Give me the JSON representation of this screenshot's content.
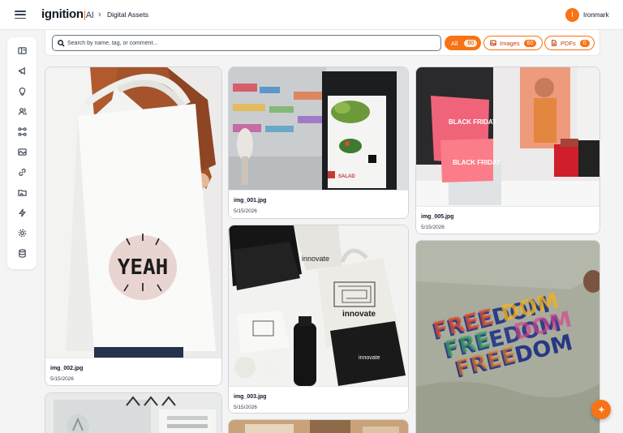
{
  "header": {
    "logo_text": "ignition",
    "logo_suffix": "AI",
    "breadcrumb_sep": "›",
    "breadcrumb": "Digital Assets",
    "user_initial": "I",
    "user_name": "Ironmark"
  },
  "sidebar": {
    "icons": [
      "dashboard-icon",
      "megaphone-icon",
      "lightbulb-icon",
      "users-icon",
      "workflow-icon",
      "image-gallery-icon",
      "link-icon",
      "folder-image-icon",
      "lightning-icon",
      "settings-icon",
      "database-icon"
    ]
  },
  "search": {
    "placeholder": "Search by name, tag, or comment...",
    "value": ""
  },
  "filters": {
    "all_label": "All",
    "all_count": "60",
    "images_label": "Images",
    "images_count": "60",
    "pdfs_label": "PDFs",
    "pdfs_count": "0"
  },
  "cards": [
    {
      "file": "img_002.jpg",
      "date": "5/15/2026"
    },
    {
      "file": "img_001.jpg",
      "date": "5/15/2026"
    },
    {
      "file": "img_003.jpg",
      "date": "5/15/2026"
    },
    {
      "file": "img_005.jpg",
      "date": "5/15/2026"
    }
  ],
  "image_text": {
    "tote": "YEAH",
    "kiosk": "SALAD",
    "sale1": "BLACK FRIDAY",
    "sale2": "BLACK FRIDAY",
    "innovate": "innovate",
    "freedom": "FREEDOM"
  },
  "colors": {
    "accent": "#f97316",
    "accent_light": "#ffedd5"
  }
}
